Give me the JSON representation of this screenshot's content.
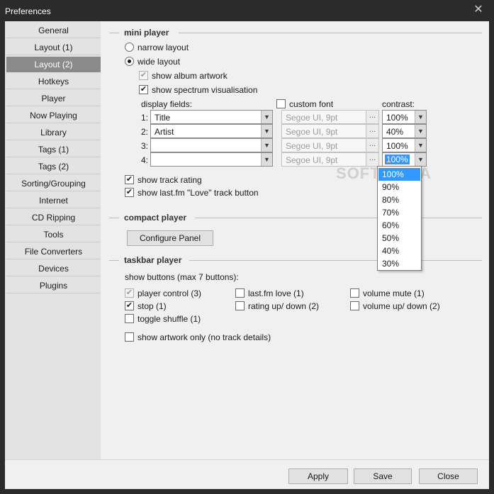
{
  "window": {
    "title": "Preferences",
    "close_glyph": "✕"
  },
  "sidebar": {
    "items": [
      {
        "label": "General"
      },
      {
        "label": "Layout (1)"
      },
      {
        "label": "Layout (2)"
      },
      {
        "label": "Hotkeys"
      },
      {
        "label": "Player"
      },
      {
        "label": "Now Playing"
      },
      {
        "label": "Library"
      },
      {
        "label": "Tags (1)"
      },
      {
        "label": "Tags (2)"
      },
      {
        "label": "Sorting/Grouping"
      },
      {
        "label": "Internet"
      },
      {
        "label": "CD Ripping"
      },
      {
        "label": "Tools"
      },
      {
        "label": "File Converters"
      },
      {
        "label": "Devices"
      },
      {
        "label": "Plugins"
      }
    ],
    "selected": "Layout (2)"
  },
  "mini_player": {
    "title": "mini player",
    "narrow_layout": "narrow layout",
    "wide_layout": "wide layout",
    "show_album_artwork": "show album artwork",
    "show_spectrum": "show spectrum visualisation",
    "display_fields_label": "display fields:",
    "custom_font_label": "custom font",
    "contrast_label": "contrast:",
    "rows": [
      {
        "num": "1:",
        "field": "Title",
        "font": "Segoe UI, 9pt",
        "contrast": "100%"
      },
      {
        "num": "2:",
        "field": "Artist",
        "font": "Segoe UI, 9pt",
        "contrast": "40%"
      },
      {
        "num": "3:",
        "field": "",
        "font": "Segoe UI, 9pt",
        "contrast": "100%"
      },
      {
        "num": "4:",
        "field": "",
        "font": "Segoe UI, 9pt",
        "contrast": "100%"
      }
    ],
    "font_button": "...",
    "show_track_rating": "show track rating",
    "show_lastfm_love": "show last.fm \"Love\" track button"
  },
  "contrast_dropdown": {
    "options": [
      "100%",
      "90%",
      "80%",
      "70%",
      "60%",
      "50%",
      "40%",
      "30%"
    ],
    "highlighted": "100%"
  },
  "compact_player": {
    "title": "compact player",
    "configure_button": "Configure Panel"
  },
  "taskbar_player": {
    "title": "taskbar player",
    "show_buttons_label": "show buttons (max 7 buttons):",
    "player_control": "player control (3)",
    "lastfm_love": "last.fm love (1)",
    "volume_mute": "volume mute (1)",
    "stop": "stop (1)",
    "rating_up_down": "rating up/ down (2)",
    "volume_up_down": "volume up/ down (2)",
    "toggle_shuffle": "toggle shuffle (1)",
    "show_artwork_only": "show artwork only (no track details)"
  },
  "footer": {
    "apply": "Apply",
    "save": "Save",
    "close": "Close"
  },
  "watermark": "SOFTPEDIA",
  "glyphs": {
    "check": "✔",
    "arrow_down": "▼"
  }
}
